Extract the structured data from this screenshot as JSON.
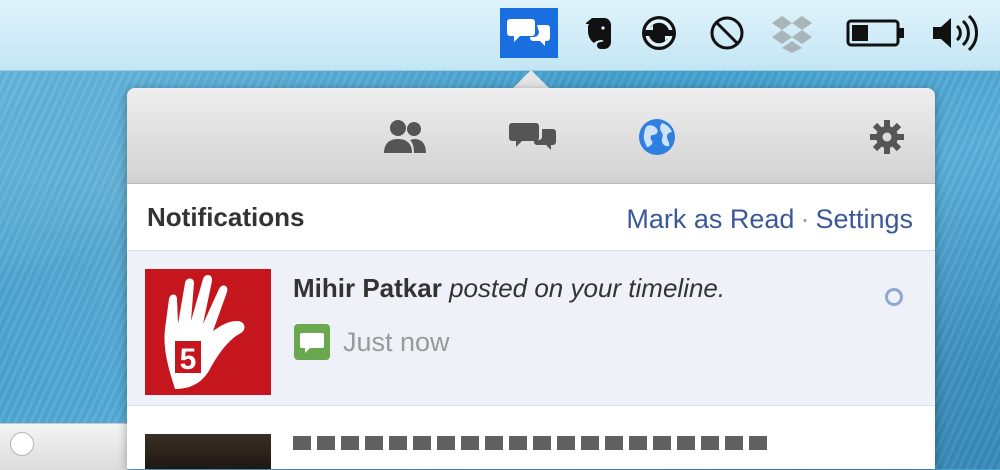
{
  "menubar": {
    "icons": [
      {
        "name": "facebook-notifications-icon",
        "active": true
      },
      {
        "name": "evernote-icon"
      },
      {
        "name": "sync-icon"
      },
      {
        "name": "no-sign-icon"
      },
      {
        "name": "dropbox-icon"
      },
      {
        "name": "battery-icon",
        "level": 0.35
      },
      {
        "name": "volume-icon"
      }
    ],
    "colors": {
      "active_bg": "#1a6fe0"
    }
  },
  "popup": {
    "tabs": [
      {
        "name": "friend-requests-icon"
      },
      {
        "name": "messages-icon"
      },
      {
        "name": "notifications-globe-icon",
        "active": true
      },
      {
        "name": "settings-gear-icon"
      }
    ],
    "header": {
      "title": "Notifications",
      "mark_read": "Mark as Read",
      "separator": "·",
      "settings": "Settings"
    },
    "notifications": [
      {
        "actor": "Mihir Patkar",
        "action": "posted on your timeline.",
        "time": "Just now",
        "avatar_text": "5",
        "avatar_color": "#c4161c",
        "type_icon": "comment-icon"
      }
    ],
    "colors": {
      "link": "#3b5998",
      "globe": "#2f7fe0",
      "unread_bg": "#eef1f7"
    }
  }
}
